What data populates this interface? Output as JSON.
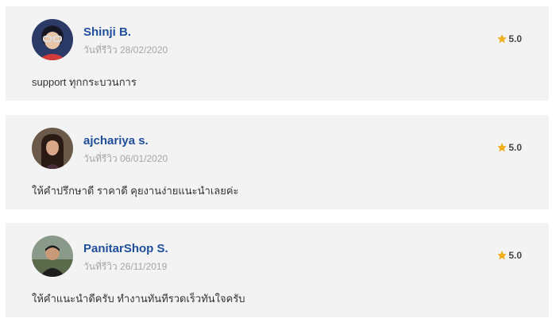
{
  "reviews": [
    {
      "name": "Shinji B.",
      "date": "วันที่รีวิว 28/02/2020",
      "rating": "5.0",
      "text": "support ทุกกระบวนการ",
      "avatar_icon": "person-with-glasses-avatar"
    },
    {
      "name": "ajchariya s.",
      "date": "วันที่รีวิว 06/01/2020",
      "rating": "5.0",
      "text": "ให้คำปรึกษาดี ราคาดี คุยงานง่ายแนะนำเลยค่ะ",
      "avatar_icon": "woman-long-hair-avatar"
    },
    {
      "name": "PanitarShop S.",
      "date": "วันที่รีวิว 26/11/2019",
      "rating": "5.0",
      "text": "ให้คำแนะนำดีครับ ทำงานทันทีรวดเร็วทันใจครับ",
      "avatar_icon": "man-outdoor-avatar"
    }
  ],
  "colors": {
    "card_bg": "#f3f3f3",
    "name": "#1f4f9a",
    "date": "#a6a6a6",
    "star": "#f2b01e",
    "text": "#333333"
  }
}
